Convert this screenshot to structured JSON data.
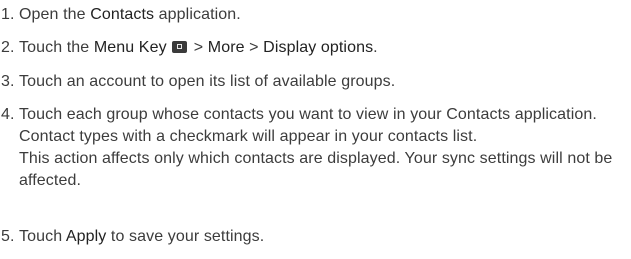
{
  "steps": [
    {
      "number": "1.",
      "before": "Open the ",
      "bold": "Contacts",
      "after": " application."
    },
    {
      "number": "2.",
      "before": "Touch the ",
      "bold1": "Menu Key",
      "icon": "menu-key-icon",
      "sep1": " > ",
      "bold2": "More",
      "sep2": " > ",
      "bold3": "Display options",
      "after": "."
    },
    {
      "number": "3.",
      "text": "Touch an account to open its list of available groups."
    },
    {
      "number": "4.",
      "text": "Touch each group whose contacts you want to view in your Contacts application. Contact types with a checkmark will appear in your contacts list.",
      "note": "This action affects only which contacts are displayed. Your sync settings will not be affected."
    },
    {
      "number": "5.",
      "before": "Touch ",
      "bold": "Apply",
      "after": " to save your settings."
    }
  ]
}
